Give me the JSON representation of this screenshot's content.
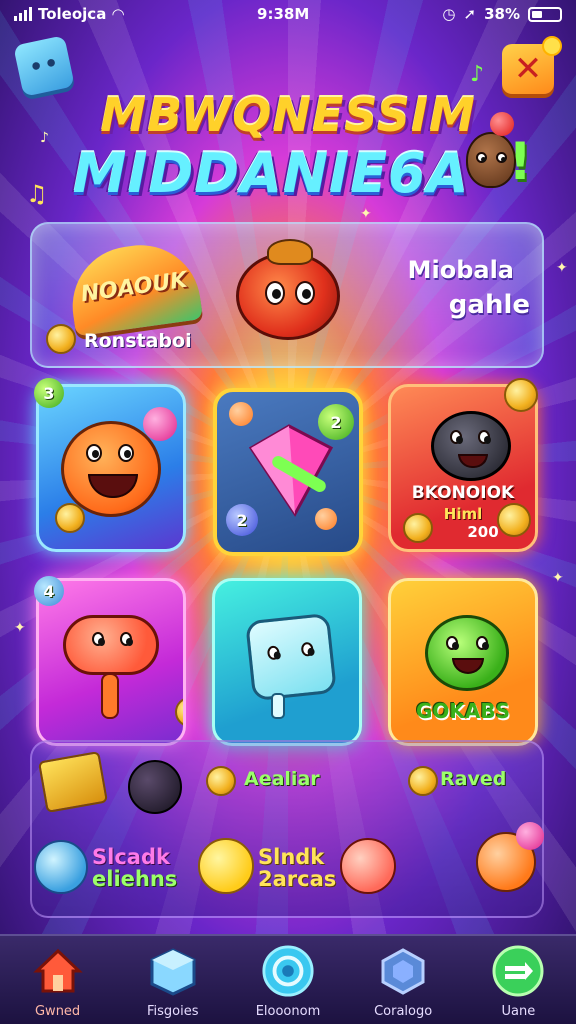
{
  "status_bar": {
    "carrier": "Toleojca",
    "time": "9:38M",
    "battery": "38%",
    "battery_level": 0.38
  },
  "title": {
    "line1": "MBWQNESSIM",
    "line2": "MIDDANIE6A"
  },
  "banner": {
    "badge_text": "NOAOUK",
    "left_label": "Ronstaboi",
    "right_line1": "Miobala",
    "right_line2": "gahle"
  },
  "tiles": [
    {
      "name": "orange-monster",
      "badge": "3"
    },
    {
      "name": "pink-gem",
      "badge_top": "2",
      "badge_bottom": "2"
    },
    {
      "name": "bear-promo",
      "line1": "BKONOIOK",
      "line2": "Himl",
      "line3": "200"
    },
    {
      "name": "pink-lollipop",
      "badge": "4"
    },
    {
      "name": "ice-cube"
    },
    {
      "name": "green-bear",
      "label": "GOKABS"
    }
  ],
  "lower_panel": {
    "row1_left_label": "Aealiar",
    "row1_right_label": "Raved",
    "promo1_line1": "Slcadk",
    "promo1_line2": "eliehns",
    "promo2_line1": "Slndk",
    "promo2_line2": "2arcas"
  },
  "nav": {
    "items": [
      {
        "label": "Gwned",
        "icon": "home-icon",
        "active": true
      },
      {
        "label": "Fisgoies",
        "icon": "cube-icon",
        "active": false
      },
      {
        "label": "Elooonom",
        "icon": "target-icon",
        "active": false
      },
      {
        "label": "Coralogo",
        "icon": "hexagon-icon",
        "active": false
      },
      {
        "label": "Uane",
        "icon": "play-icon",
        "active": false
      }
    ]
  },
  "colors": {
    "title_gold": "#ffd12a",
    "title_cyan": "#66f0ff",
    "label_green": "#9cff6a",
    "nav_bg": "#1c1240"
  }
}
